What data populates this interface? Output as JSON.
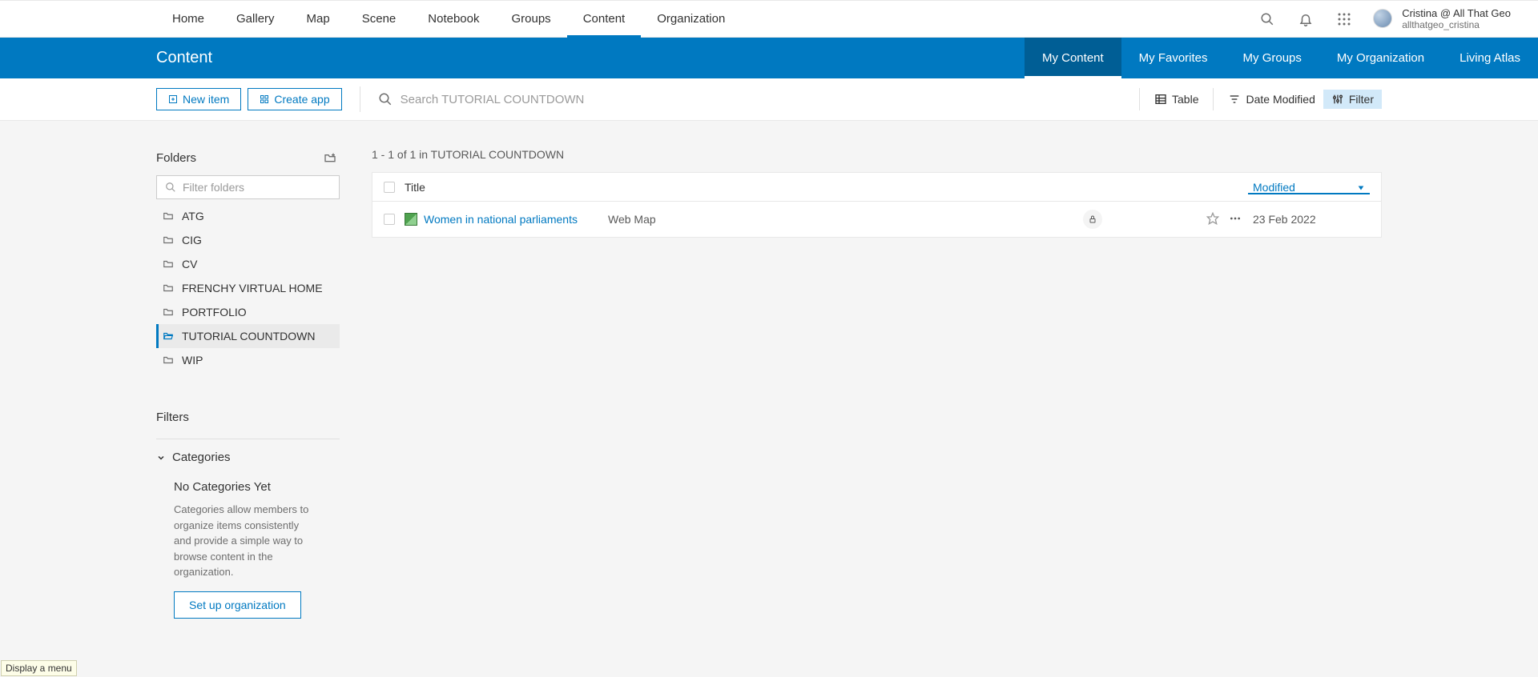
{
  "topnav": {
    "items": [
      "Home",
      "Gallery",
      "Map",
      "Scene",
      "Notebook",
      "Groups",
      "Content",
      "Organization"
    ],
    "active_index": 6,
    "user": {
      "display": "Cristina @ All That Geo",
      "handle": "allthatgeo_cristina"
    }
  },
  "subnav": {
    "title": "Content",
    "tabs": [
      "My Content",
      "My Favorites",
      "My Groups",
      "My Organization",
      "Living Atlas"
    ],
    "active_index": 0
  },
  "toolbar": {
    "new_item": "New item",
    "create_app": "Create app",
    "search_placeholder": "Search TUTORIAL COUNTDOWN",
    "table": "Table",
    "date_modified": "Date Modified",
    "filter": "Filter"
  },
  "sidebar": {
    "folders_label": "Folders",
    "filter_placeholder": "Filter folders",
    "folders": [
      "ATG",
      "CIG",
      "CV",
      "FRENCHY VIRTUAL HOME",
      "PORTFOLIO",
      "TUTORIAL COUNTDOWN",
      "WIP"
    ],
    "active_folder_index": 5,
    "filters_label": "Filters",
    "categories_label": "Categories",
    "no_categories_title": "No Categories Yet",
    "no_categories_desc": "Categories allow members to organize items consistently and provide a simple way to browse content in the organization.",
    "setup_label": "Set up organization"
  },
  "content": {
    "result_count": "1 - 1 of 1 in TUTORIAL COUNTDOWN",
    "columns": {
      "title": "Title",
      "modified": "Modified"
    },
    "rows": [
      {
        "title": "Women in national parliaments",
        "type": "Web Map",
        "date": "23 Feb 2022"
      }
    ]
  },
  "tooltip": "Display a menu"
}
